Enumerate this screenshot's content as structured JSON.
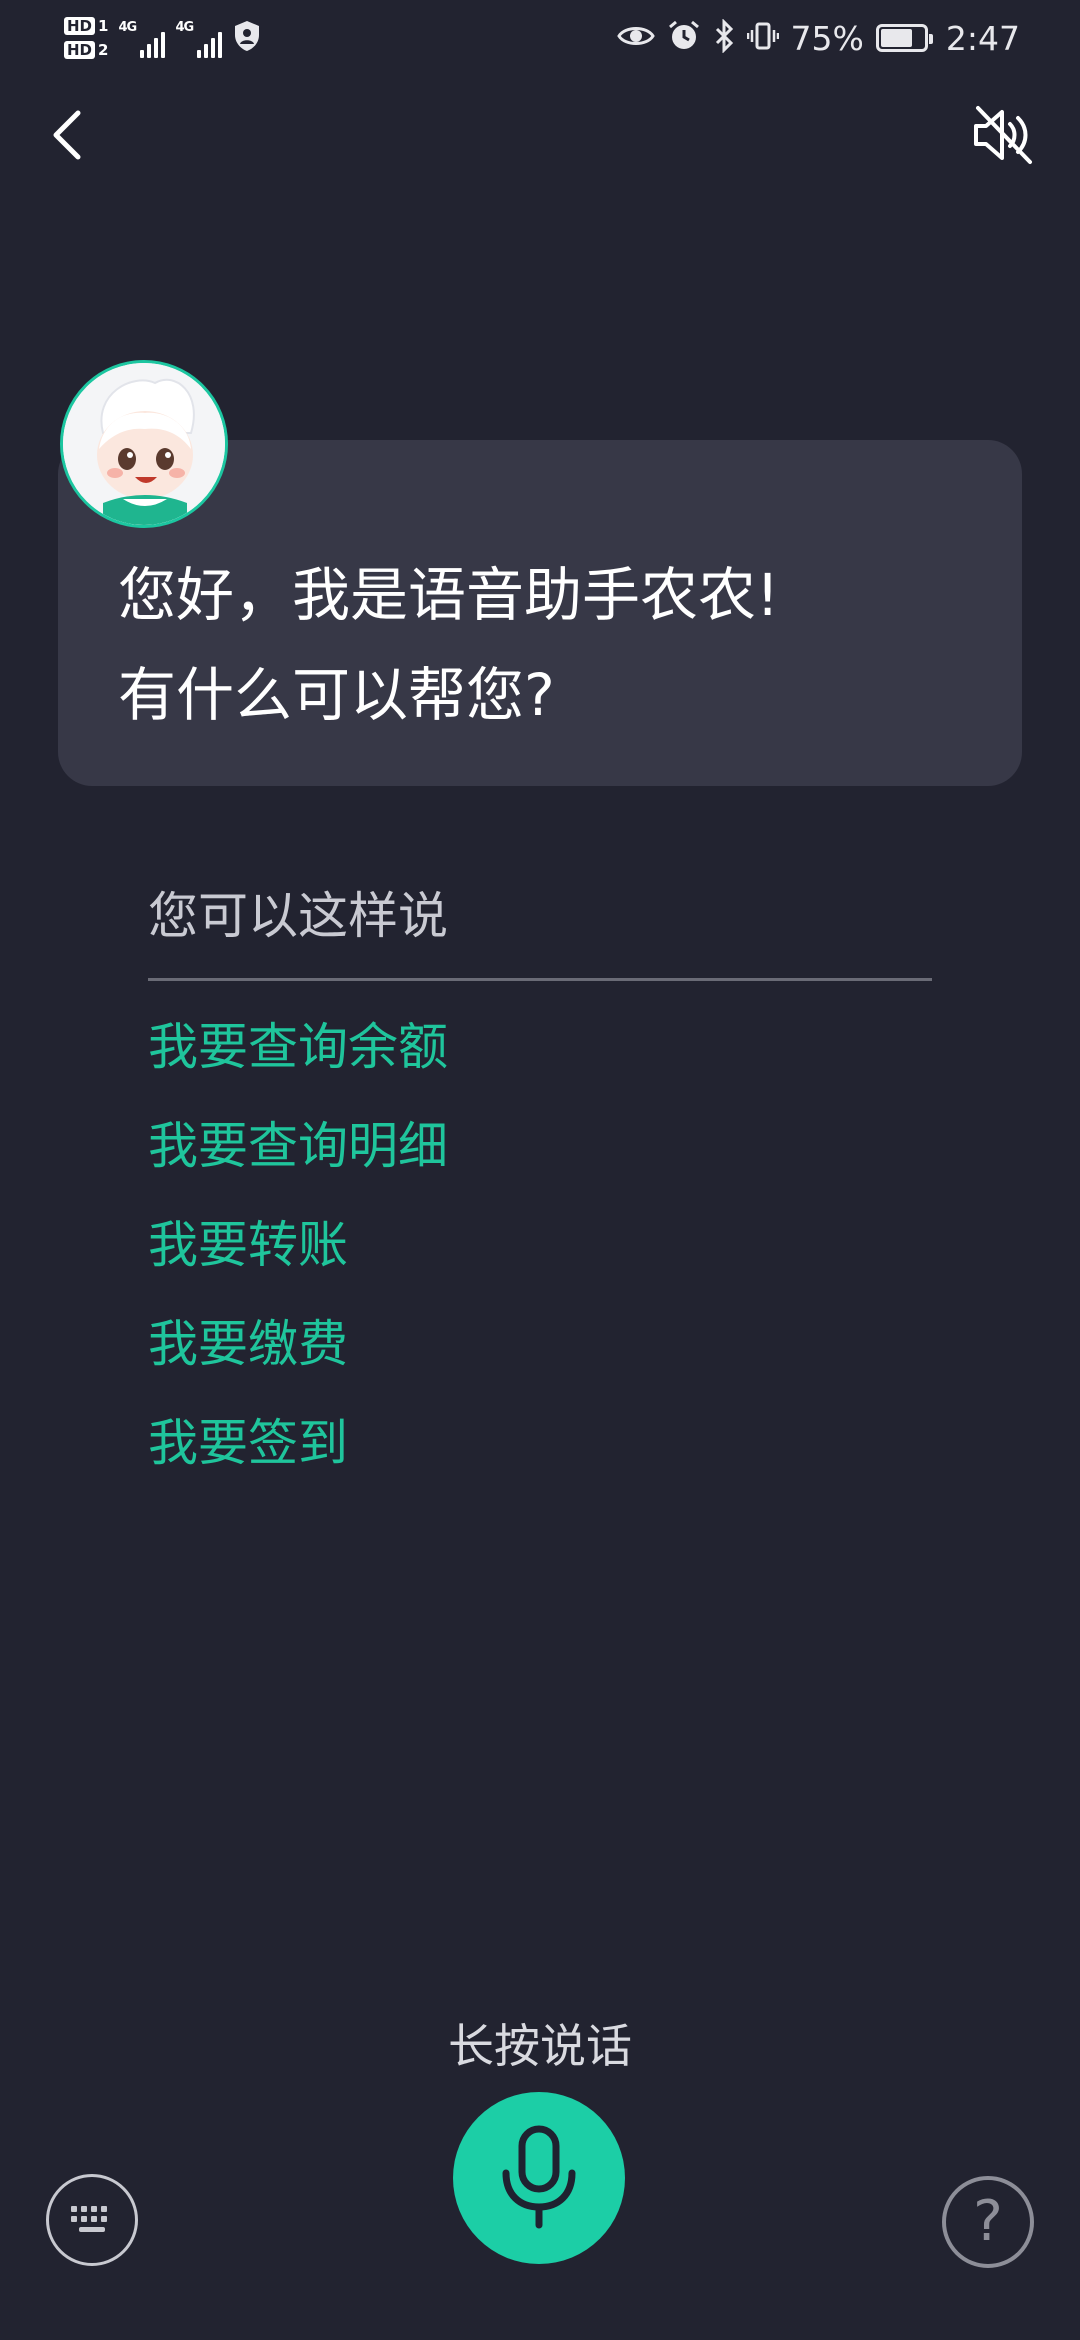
{
  "status_bar": {
    "sim1_badge": "HD",
    "sim1_number": "1",
    "sim2_badge": "HD",
    "sim2_number": "2",
    "network1": "4G",
    "network2": "4G",
    "battery_percent_text": "75%",
    "battery_level": 0.75,
    "time": "2:47",
    "icons": [
      "eye-icon",
      "alarm-icon",
      "bluetooth-icon",
      "vibrate-icon",
      "battery-icon"
    ]
  },
  "header": {
    "back_icon": "chevron-left-icon",
    "mute_icon": "speaker-muted-icon"
  },
  "greeting": {
    "line1": "您好，我是语音助手农农!",
    "line2": "有什么可以帮您?"
  },
  "suggestions": {
    "title": "您可以这样说",
    "items": [
      "我要查询余额",
      "我要查询明细",
      "我要转账",
      "我要缴费",
      "我要签到"
    ]
  },
  "bottom": {
    "hold_to_talk": "长按说话",
    "mic_icon": "microphone-icon",
    "keyboard_icon": "keyboard-icon",
    "help_icon": "question-mark-icon",
    "help_glyph": "?"
  },
  "colors": {
    "background": "#222330",
    "bubble": "#373847",
    "accent_green": "#1fc59c",
    "mic_button": "#1ccea6"
  }
}
